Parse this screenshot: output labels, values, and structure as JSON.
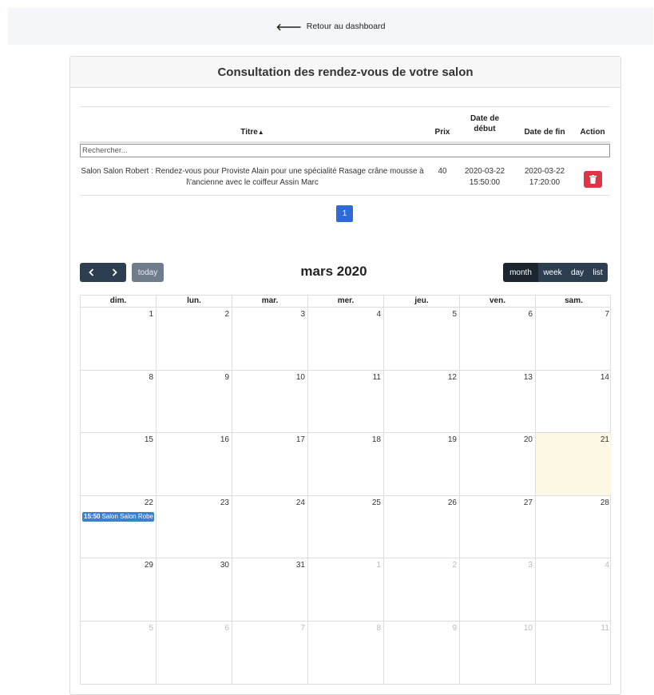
{
  "topbar": {
    "back_label": "Retour au dashboard"
  },
  "card": {
    "title": "Consultation des rendez-vous de votre salon"
  },
  "table": {
    "headers": {
      "titre": "Titre",
      "prix": "Prix",
      "debut": "Date de début",
      "fin": "Date de fin",
      "action": "Action"
    },
    "search_placeholder": "Rechercher...",
    "rows": [
      {
        "titre": "Salon Salon Robert : Rendez-vous pour Proviste Alain pour une spécialité Rasage crâne mousse à l\\'ancienne avec le coiffeur Assin Marc",
        "prix": "40",
        "debut": "2020-03-22 15:50:00",
        "fin": "2020-03-22 17:20:00"
      }
    ],
    "pagination": {
      "current": "1"
    }
  },
  "calendar": {
    "title": "mars 2020",
    "prev_label": "‹",
    "next_label": "›",
    "today_label": "today",
    "views": {
      "month": "month",
      "week": "week",
      "day": "day",
      "list": "list"
    },
    "weekdays": [
      "dim.",
      "lun.",
      "mar.",
      "mer.",
      "jeu.",
      "ven.",
      "sam."
    ],
    "weeks": [
      [
        "1",
        "2",
        "3",
        "4",
        "5",
        "6",
        "7"
      ],
      [
        "8",
        "9",
        "10",
        "11",
        "12",
        "13",
        "14"
      ],
      [
        "15",
        "16",
        "17",
        "18",
        "19",
        "20",
        "21"
      ],
      [
        "22",
        "23",
        "24",
        "25",
        "26",
        "27",
        "28"
      ],
      [
        "29",
        "30",
        "31",
        "1",
        "2",
        "3",
        "4"
      ],
      [
        "5",
        "6",
        "7",
        "8",
        "9",
        "10",
        "11"
      ]
    ],
    "event": {
      "time": "15:50",
      "title": "Salon Salon Robe"
    }
  },
  "colors": {
    "danger": "#dc3545",
    "primary": "#2e6bd8",
    "dark": "#2c3e50",
    "today_bg": "#fcf8e3",
    "event": "#3b7fd6"
  }
}
